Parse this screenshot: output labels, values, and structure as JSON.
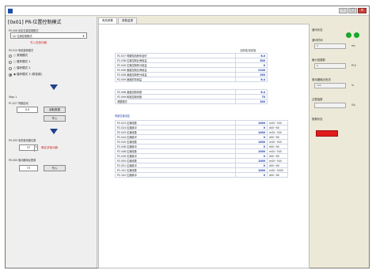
{
  "window": {
    "title": "",
    "controls": [
      "–",
      "□",
      "×"
    ]
  },
  "left": {
    "header_bracket": "[0x01]",
    "header_title": "PR-位置控制模式",
    "label_top": "P0.006 设定位置控制模式",
    "combo_value": "(0) 位置控制模式",
    "red_link": "写入至驱动器",
    "label_mode": "P0.010 电机旋转模式",
    "radios": [
      {
        "label": "○ 常规模式",
        "on": false
      },
      {
        "label": "○ 循环模式 1",
        "on": false
      },
      {
        "label": "○ 循环模式 2",
        "on": false
      },
      {
        "label": "◉ 循环模式 3 (带变频)",
        "on": true
      }
    ],
    "step1": "Step 1",
    "step1_label": "P1.027 伺服启动",
    "input1": "0.0",
    "btn_write": "写入",
    "btn_read": "读取数据",
    "label_step2": "P0.030 电机驱动器位置",
    "input2": "37",
    "red_step2": "确定该驱动器",
    "label_step3": "P0.000 驱动器地址配置",
    "input3": "73",
    "btn_write2": "写入"
  },
  "tabs": [
    "电机参数",
    "参数监视"
  ],
  "main": {
    "group1_header": "当前值/设定值",
    "group1": [
      {
        "label": "P2.037 伺服电机刹车延时",
        "value": "6.0",
        "unit": ""
      },
      {
        "label": "P2.038 位置控制比例增益",
        "value": "500",
        "unit": ""
      },
      {
        "label": "P2.040 位置控制积分增益",
        "value": "0",
        "unit": ""
      },
      {
        "label": "P2.056 速度控制比例增益",
        "value": "2100",
        "unit": ""
      },
      {
        "label": "P2.058 速度控制积分增益",
        "value": "250",
        "unit": ""
      },
      {
        "label": "P2.059 速度前馈增益",
        "value": "6.4",
        "unit": ""
      }
    ],
    "group2": [
      {
        "label": "P2.098 速度控制系数",
        "value": "6.4",
        "unit": ""
      },
      {
        "label": "P2.099 转矩控制系数",
        "value": "75",
        "unit": ""
      },
      {
        "label": "调整模式",
        "value": "300",
        "unit": ""
      }
    ],
    "group3_header": "内部位置设定",
    "group3": [
      {
        "label": "P2.023 位置段数",
        "value": "1000",
        "unit": "mS0~500"
      },
      {
        "label": "P2.024 位置脉冲",
        "value": "0",
        "unit": "d00~60"
      },
      {
        "label": "P2.043 位置段数",
        "value": "1000",
        "unit": "mS0~500"
      },
      {
        "label": "P2.044 位置脉冲",
        "value": "0",
        "unit": "d00~60"
      },
      {
        "label": "P2.045 位置段数",
        "value": "1000",
        "unit": "mS0~500"
      },
      {
        "label": "P2.046 位置脉冲",
        "value": "0",
        "unit": "d00~60"
      },
      {
        "label": "P2.048 位置段数",
        "value": "1000",
        "unit": "mS0~500"
      },
      {
        "label": "P2.049 位置脉冲",
        "value": "0",
        "unit": "d00~60"
      },
      {
        "label": "P2.050 位置段数",
        "value": "1000",
        "unit": "mS0~500"
      },
      {
        "label": "P2.051 位置脉冲",
        "value": "0",
        "unit": "d00~60"
      },
      {
        "label": "P2.101 位置段数",
        "value": "1000",
        "unit": "mS0~5000"
      },
      {
        "label": "P2.102 位置脉冲",
        "value": "0",
        "unit": "d00~60"
      }
    ]
  },
  "right": {
    "status_label": "通讯状态",
    "led_colors": [
      "#19a72a",
      "#19a72a"
    ],
    "rows": [
      {
        "label": "通讯时间",
        "value": "0",
        "unit": "ms"
      },
      {
        "label": "最大回路数",
        "value": "0",
        "unit": "PLS"
      },
      {
        "label": "驱动器输出电流",
        "value": "100",
        "unit": "%"
      },
      {
        "label": "过载指数",
        "value": "",
        "unit": "0%"
      },
      {
        "label": "报警状态",
        "value": "",
        "unit": ""
      }
    ],
    "alarm_color": "#e01b1b"
  }
}
